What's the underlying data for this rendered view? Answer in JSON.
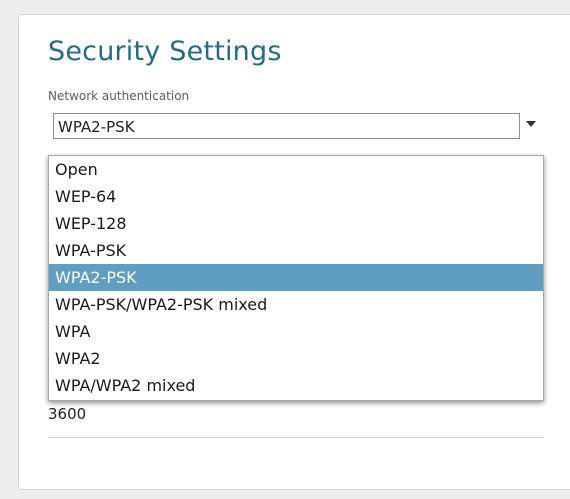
{
  "security": {
    "title": "Security Settings",
    "network_authentication": {
      "label": "Network authentication",
      "selected": "WPA2-PSK",
      "options": [
        "Open",
        "WEP-64",
        "WEP-128",
        "WPA-PSK",
        "WPA2-PSK",
        "WPA-PSK/WPA2-PSK mixed",
        "WPA",
        "WPA2",
        "WPA/WPA2 mixed"
      ],
      "highlighted_index": 4
    },
    "hidden_field_value": "3600"
  },
  "colors": {
    "title": "#1e6e8a",
    "highlight": "#5f9ec0"
  }
}
